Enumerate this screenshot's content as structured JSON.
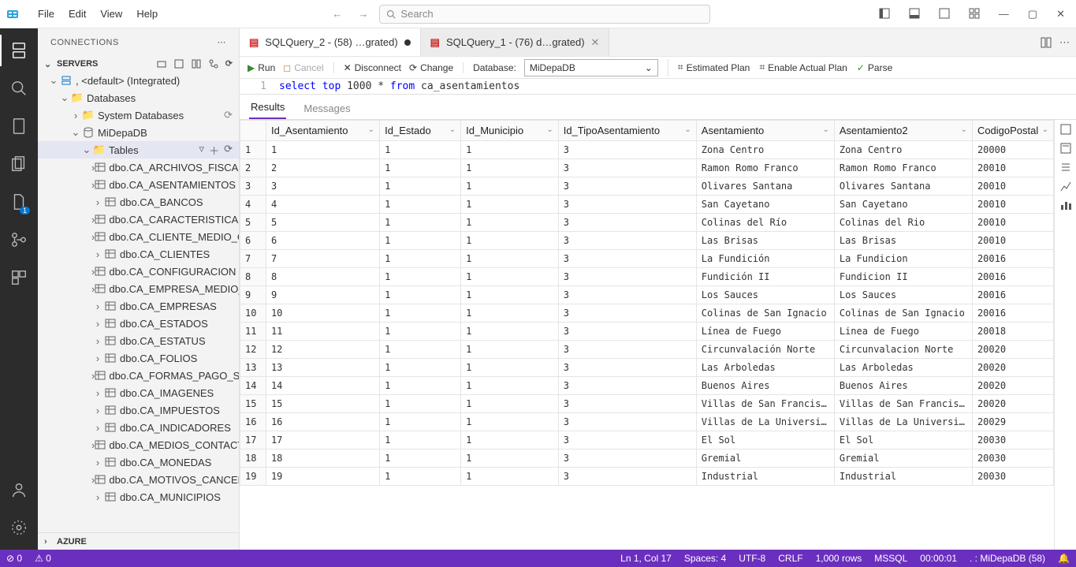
{
  "menubar": {
    "file": "File",
    "edit": "Edit",
    "view": "View",
    "help": "Help"
  },
  "search_placeholder": "Search",
  "connections_title": "CONNECTIONS",
  "servers_label": "SERVERS",
  "azure_label": "AZURE",
  "tree": {
    "server": ", <default> (Integrated)",
    "databases": "Databases",
    "sysdb": "System Databases",
    "db": "MiDepaDB",
    "tables": "Tables",
    "table_items": [
      "dbo.CA_ARCHIVOS_FISCALES",
      "dbo.CA_ASENTAMIENTOS",
      "dbo.CA_BANCOS",
      "dbo.CA_CARACTERISTICAS",
      "dbo.CA_CLIENTE_MEDIO_CO…",
      "dbo.CA_CLIENTES",
      "dbo.CA_CONFIGURACION",
      "dbo.CA_EMPRESA_MEDIO_C…",
      "dbo.CA_EMPRESAS",
      "dbo.CA_ESTADOS",
      "dbo.CA_ESTATUS",
      "dbo.CA_FOLIOS",
      "dbo.CA_FORMAS_PAGO_SAT",
      "dbo.CA_IMAGENES",
      "dbo.CA_IMPUESTOS",
      "dbo.CA_INDICADORES",
      "dbo.CA_MEDIOS_CONTACTOS",
      "dbo.CA_MONEDAS",
      "dbo.CA_MOTIVOS_CANCELA…",
      "dbo.CA_MUNICIPIOS"
    ]
  },
  "tabs": [
    {
      "label": "SQLQuery_2 - (58) …grated)",
      "dirty": true,
      "active": true
    },
    {
      "label": "SQLQuery_1 - (76) d…grated)",
      "dirty": false,
      "active": false
    }
  ],
  "toolbar": {
    "run": "Run",
    "cancel": "Cancel",
    "disconnect": "Disconnect",
    "change": "Change",
    "database_label": "Database:",
    "database_value": "MiDepaDB",
    "estplan": "Estimated Plan",
    "actualplan": "Enable Actual Plan",
    "parse": "Parse"
  },
  "code": {
    "line_no": "1",
    "text_kw": "select top",
    "text_num": "1000",
    "text_star": "*",
    "text_from": "from",
    "text_tbl": "ca_asentamientos"
  },
  "result_tabs": {
    "results": "Results",
    "messages": "Messages"
  },
  "columns": [
    "Id_Asentamiento",
    "Id_Estado",
    "Id_Municipio",
    "Id_TipoAsentamiento",
    "Asentamiento",
    "Asentamiento2",
    "CodigoPostal"
  ],
  "rows": [
    [
      "1",
      "1",
      "1",
      "1",
      "3",
      "Zona Centro",
      "Zona Centro",
      "20000"
    ],
    [
      "2",
      "2",
      "1",
      "1",
      "3",
      "Ramon Romo Franco",
      "Ramon Romo Franco",
      "20010"
    ],
    [
      "3",
      "3",
      "1",
      "1",
      "3",
      "Olivares Santana",
      "Olivares Santana",
      "20010"
    ],
    [
      "4",
      "4",
      "1",
      "1",
      "3",
      "San Cayetano",
      "San Cayetano",
      "20010"
    ],
    [
      "5",
      "5",
      "1",
      "1",
      "3",
      "Colinas del Río",
      "Colinas del Rio",
      "20010"
    ],
    [
      "6",
      "6",
      "1",
      "1",
      "3",
      "Las Brisas",
      "Las Brisas",
      "20010"
    ],
    [
      "7",
      "7",
      "1",
      "1",
      "3",
      "La Fundición",
      "La Fundicion",
      "20016"
    ],
    [
      "8",
      "8",
      "1",
      "1",
      "3",
      "Fundición II",
      "Fundicion II",
      "20016"
    ],
    [
      "9",
      "9",
      "1",
      "1",
      "3",
      "Los Sauces",
      "Los Sauces",
      "20016"
    ],
    [
      "10",
      "10",
      "1",
      "1",
      "3",
      "Colinas de San Ignacio",
      "Colinas de San Ignacio",
      "20016"
    ],
    [
      "11",
      "11",
      "1",
      "1",
      "3",
      "Línea de Fuego",
      "Linea de Fuego",
      "20018"
    ],
    [
      "12",
      "12",
      "1",
      "1",
      "3",
      "Circunvalación Norte",
      "Circunvalacion Norte",
      "20020"
    ],
    [
      "13",
      "13",
      "1",
      "1",
      "3",
      "Las Arboledas",
      "Las Arboledas",
      "20020"
    ],
    [
      "14",
      "14",
      "1",
      "1",
      "3",
      "Buenos Aires",
      "Buenos Aires",
      "20020"
    ],
    [
      "15",
      "15",
      "1",
      "1",
      "3",
      "Villas de San Francisco",
      "Villas de San Francisco",
      "20020"
    ],
    [
      "16",
      "16",
      "1",
      "1",
      "3",
      "Villas de La Universid…",
      "Villas de La Universid…",
      "20029"
    ],
    [
      "17",
      "17",
      "1",
      "1",
      "3",
      "El Sol",
      "El Sol",
      "20030"
    ],
    [
      "18",
      "18",
      "1",
      "1",
      "3",
      "Gremial",
      "Gremial",
      "20030"
    ],
    [
      "19",
      "19",
      "1",
      "1",
      "3",
      "Industrial",
      "Industrial",
      "20030"
    ]
  ],
  "status": {
    "left1": "⊘ 0",
    "left2": "⚠ 0",
    "ln": "Ln 1, Col 17",
    "spaces": "Spaces: 4",
    "enc": "UTF-8",
    "eol": "CRLF",
    "rows": "1,000 rows",
    "db": "MSSQL",
    "time": "00:00:01",
    "conn": ". : MiDepaDB (58)"
  }
}
